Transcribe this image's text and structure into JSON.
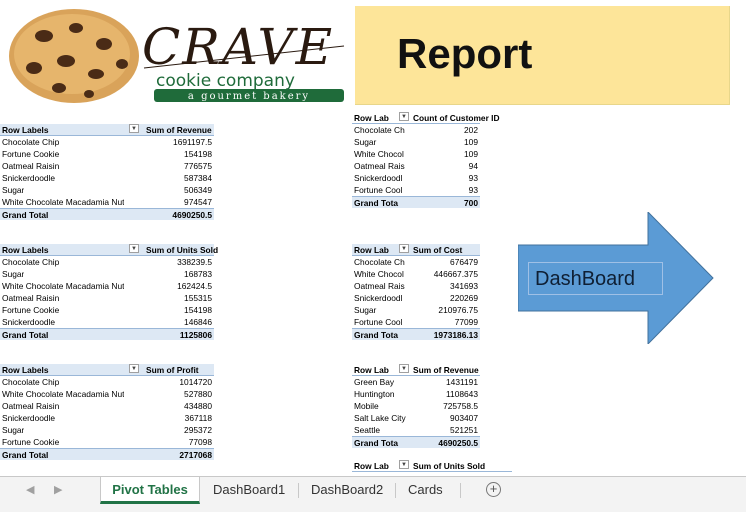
{
  "logo": {
    "brand": "CRAVE",
    "line2": "cookie company",
    "tagline": "a gourmet bakery"
  },
  "report": {
    "title": "Report"
  },
  "dashboard_shape": {
    "label": "DashBoard",
    "fill": "#5b9bd5"
  },
  "pivots": {
    "revenue_by_product": {
      "row_label": "Row Labels",
      "value_header": "Sum of Revenue",
      "rows": [
        {
          "label": "Chocolate Chip",
          "value": "1691197.5"
        },
        {
          "label": "Fortune Cookie",
          "value": "154198"
        },
        {
          "label": "Oatmeal Raisin",
          "value": "776575"
        },
        {
          "label": "Snickerdoodle",
          "value": "587384"
        },
        {
          "label": "Sugar",
          "value": "506349"
        },
        {
          "label": "White Chocolate Macadamia Nut",
          "value": "974547"
        }
      ],
      "total_label": "Grand Total",
      "total_value": "4690250.5"
    },
    "units_by_product": {
      "row_label": "Row Labels",
      "value_header": "Sum of Units Sold",
      "rows": [
        {
          "label": "Chocolate Chip",
          "value": "338239.5"
        },
        {
          "label": "Sugar",
          "value": "168783"
        },
        {
          "label": "White Chocolate Macadamia Nut",
          "value": "162424.5"
        },
        {
          "label": "Oatmeal Raisin",
          "value": "155315"
        },
        {
          "label": "Fortune Cookie",
          "value": "154198"
        },
        {
          "label": "Snickerdoodle",
          "value": "146846"
        }
      ],
      "total_label": "Grand Total",
      "total_value": "1125806"
    },
    "profit_by_product": {
      "row_label": "Row Labels",
      "value_header": "Sum of Profit",
      "rows": [
        {
          "label": "Chocolate Chip",
          "value": "1014720"
        },
        {
          "label": "White Chocolate Macadamia Nut",
          "value": "527880"
        },
        {
          "label": "Oatmeal Raisin",
          "value": "434880"
        },
        {
          "label": "Snickerdoodle",
          "value": "367118"
        },
        {
          "label": "Sugar",
          "value": "295372"
        },
        {
          "label": "Fortune Cookie",
          "value": "77098"
        }
      ],
      "total_label": "Grand Total",
      "total_value": "2717068"
    },
    "customers_by_product": {
      "row_label": "Row Lab",
      "value_header": "Count of Customer ID",
      "rows": [
        {
          "label": "Chocolate Ch",
          "value": "202"
        },
        {
          "label": "Sugar",
          "value": "109"
        },
        {
          "label": "White Chocol",
          "value": "109"
        },
        {
          "label": "Oatmeal Rais",
          "value": "94"
        },
        {
          "label": "Snickerdoodl",
          "value": "93"
        },
        {
          "label": "Fortune Cool",
          "value": "93"
        }
      ],
      "total_label": "Grand Tota",
      "total_value": "700"
    },
    "cost_by_product": {
      "row_label": "Row Lab",
      "value_header": "Sum of Cost",
      "rows": [
        {
          "label": "Chocolate Ch",
          "value": "676479"
        },
        {
          "label": "White Chocol",
          "value": "446667.375"
        },
        {
          "label": "Oatmeal Rais",
          "value": "341693"
        },
        {
          "label": "Snickerdoodl",
          "value": "220269"
        },
        {
          "label": "Sugar",
          "value": "210976.75"
        },
        {
          "label": "Fortune Cool",
          "value": "77099"
        }
      ],
      "total_label": "Grand Tota",
      "total_value": "1973186.13"
    },
    "revenue_by_city": {
      "row_label": "Row Lab",
      "value_header": "Sum of Revenue",
      "rows": [
        {
          "label": "Green Bay",
          "value": "1431191"
        },
        {
          "label": "Huntington",
          "value": "1108643"
        },
        {
          "label": "Mobile",
          "value": "725758.5"
        },
        {
          "label": "Salt Lake City",
          "value": "903407"
        },
        {
          "label": "Seattle",
          "value": "521251"
        }
      ],
      "total_label": "Grand Tota",
      "total_value": "4690250.5"
    },
    "units_by_city": {
      "row_label": "Row Lab",
      "value_header": "Sum of Units Sold"
    }
  },
  "tabs": {
    "items": [
      "Pivot Tables",
      "DashBoard1",
      "DashBoard2",
      "Cards"
    ],
    "active_index": 0,
    "add_label": "+"
  },
  "nav": {
    "prev": "◀",
    "next": "▶"
  },
  "icons": [
    "dropdown-filter-icon",
    "add-sheet-icon",
    "scroll-left-icon",
    "scroll-right-icon"
  ]
}
